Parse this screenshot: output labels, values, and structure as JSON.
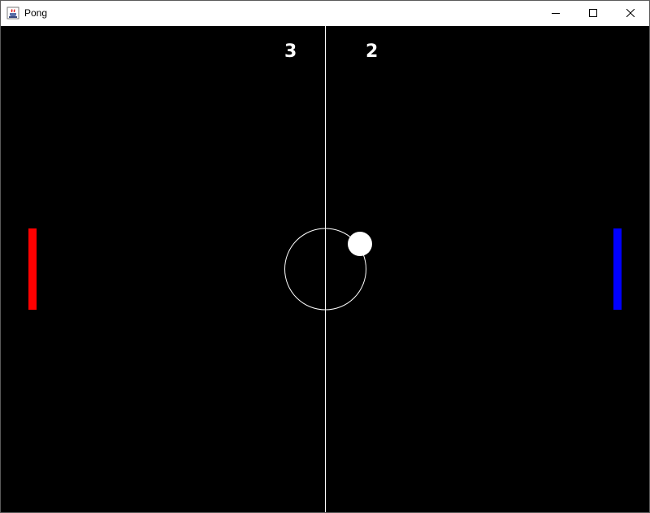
{
  "window": {
    "title": "Pong",
    "app_icon": "java-coffee-cup-icon",
    "controls": [
      "minimize-icon",
      "maximize-icon",
      "close-icon"
    ]
  },
  "game": {
    "background": "#000000",
    "score_left": "3",
    "score_right": "2",
    "left_paddle_color": "#ff0000",
    "right_paddle_color": "#0000ff",
    "ball_color": "#ffffff",
    "line_color": "#ffffff"
  }
}
